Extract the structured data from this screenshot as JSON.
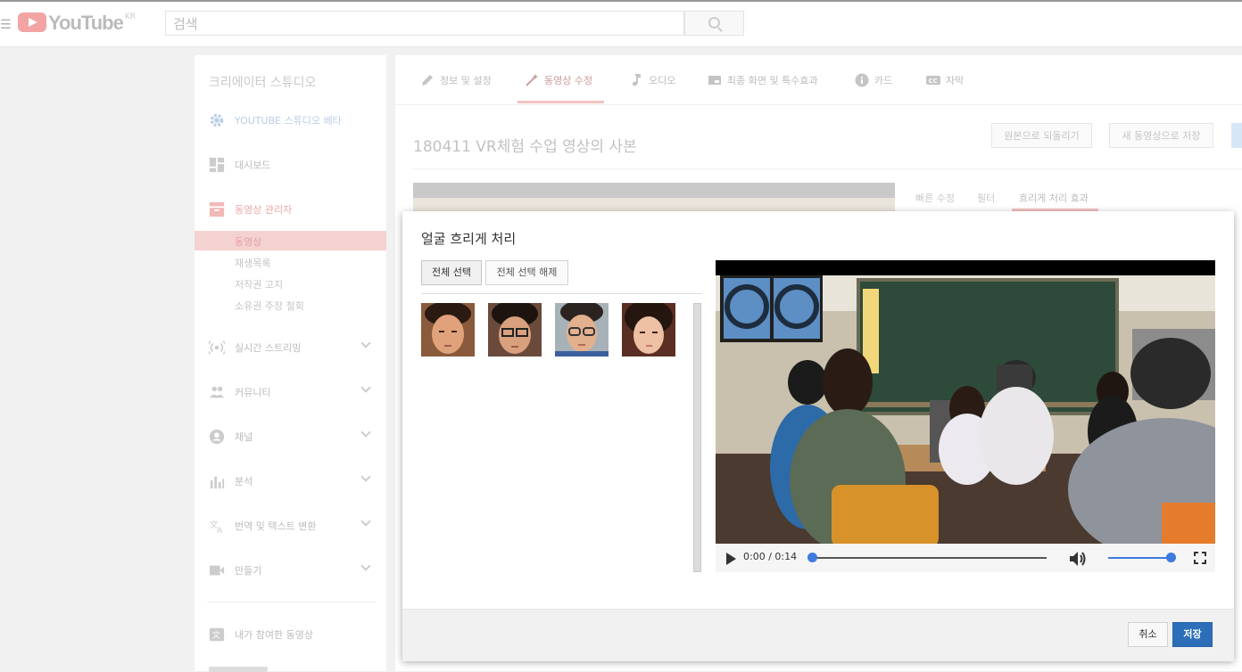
{
  "masthead": {
    "logo_text": "YouTube",
    "region": "KR",
    "search_placeholder": "검색"
  },
  "sidebar": {
    "title": "크리에이터 스튜디오",
    "items": [
      {
        "label": "YOUTUBE 스튜디오 베타",
        "icon": "gear-icon"
      },
      {
        "label": "대시보드",
        "icon": "dashboard-icon"
      },
      {
        "label": "동영상 관리자",
        "icon": "video-manager-icon"
      },
      {
        "label": "실시간 스트리밍",
        "icon": "live-icon"
      },
      {
        "label": "커뮤니티",
        "icon": "community-icon"
      },
      {
        "label": "채널",
        "icon": "channel-icon"
      },
      {
        "label": "분석",
        "icon": "analytics-icon"
      },
      {
        "label": "번역 및 텍스트 변환",
        "icon": "translate-icon"
      },
      {
        "label": "만들기",
        "icon": "create-icon"
      },
      {
        "label": "내가 참여한 동영상",
        "icon": "contributions-icon"
      }
    ],
    "sub_items": [
      "동영상",
      "재생목록",
      "저작권 고지",
      "소유권 주장 철회"
    ]
  },
  "main": {
    "tabs": [
      "정보 및 설정",
      "동영상 수정",
      "오디오",
      "최종 화면 및 특수효과",
      "카드",
      "자막"
    ],
    "active_tab": "동영상 수정",
    "video_title": "180411 VR체험 수업 영상의 사본",
    "revert_label": "원본으로 되돌리기",
    "save_new_label": "새 동영상으로 저장",
    "subtabs": [
      "빠른 수정",
      "필터",
      "흐리게 처리 효과"
    ]
  },
  "dialog": {
    "title": "얼굴 흐리게 처리",
    "select_all": "전체 선택",
    "deselect_all": "전체 선택 해제",
    "faces_count": 4,
    "player": {
      "time_display": "0:00 / 0:14",
      "progress": 0,
      "volume": 1
    },
    "cancel_label": "취소",
    "save_label": "저장"
  },
  "colors": {
    "accent_blue": "#2c6fb8",
    "slider_blue": "#3d7be0",
    "active_pink": "#f5d2d2"
  }
}
